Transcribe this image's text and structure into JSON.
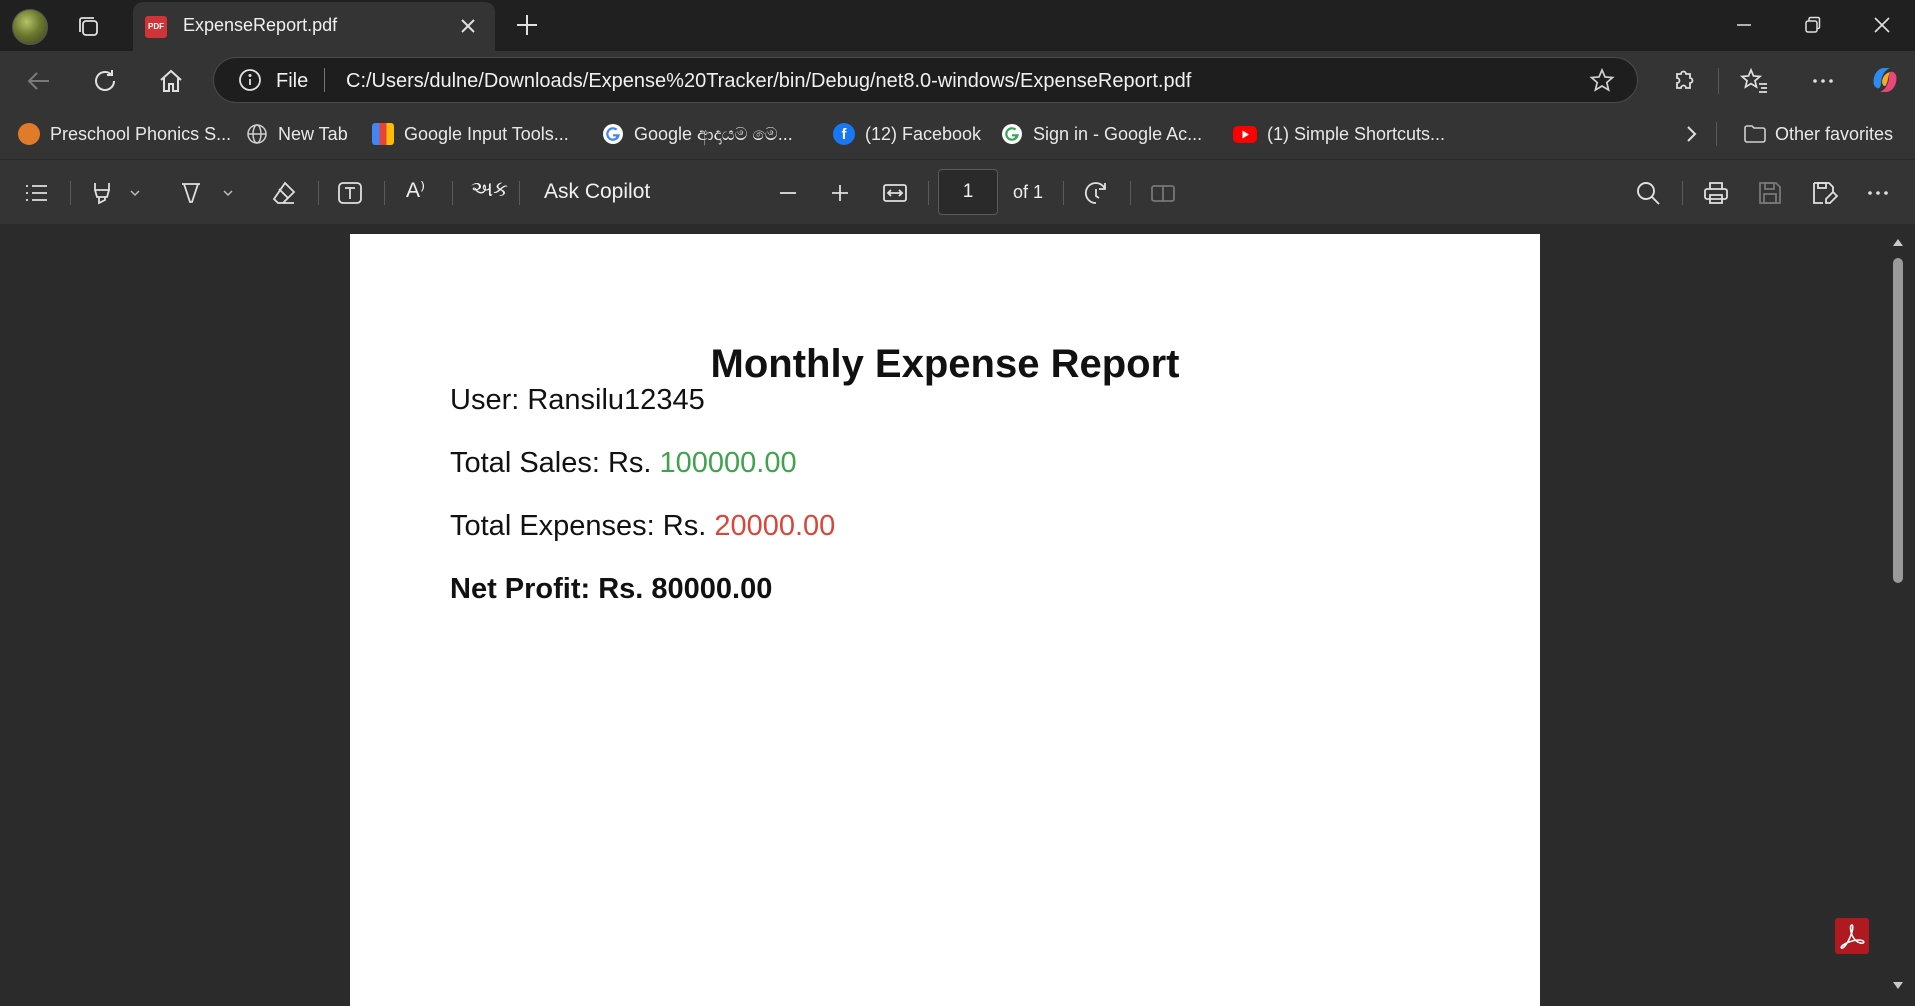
{
  "browser": {
    "tab": {
      "title": "ExpenseReport.pdf",
      "favicon": "PDF"
    },
    "address": {
      "scheme_label": "File",
      "url": "C:/Users/dulne/Downloads/Expense%20Tracker/bin/Debug/net8.0-windows/ExpenseReport.pdf"
    },
    "favorites": [
      {
        "label": "Preschool Phonics S...",
        "icon": "phonics-icon",
        "color": "#e07b2a"
      },
      {
        "label": "New Tab",
        "icon": "globe-icon",
        "color": "#cccccc"
      },
      {
        "label": "Google Input Tools...",
        "icon": "input-tools-icon",
        "color": "#4285f4"
      },
      {
        "label": "Google ආදායම මෙ...",
        "icon": "google-icon",
        "color": "#4285f4"
      },
      {
        "label": "(12) Facebook",
        "icon": "facebook-icon",
        "color": "#1877f2"
      },
      {
        "label": "Sign in - Google Ac...",
        "icon": "google-icon",
        "color": "#4285f4"
      },
      {
        "label": "(1) Simple Shortcuts...",
        "icon": "youtube-icon",
        "color": "#ff0000"
      }
    ],
    "other_favorites": "Other favorites"
  },
  "pdf_toolbar": {
    "ask_copilot": "Ask Copilot",
    "current_page": "1",
    "page_total": "of 1",
    "read_aloud_glyph": "A⁾",
    "translate_glyph": "અક"
  },
  "document": {
    "title": "Monthly Expense Report",
    "user_line": "User: Ransilu12345",
    "sales_label": "Total Sales: Rs. ",
    "sales_value": "100000.00",
    "expenses_label": "Total Expenses: Rs. ",
    "expenses_value": "20000.00",
    "net_profit_line": "Net Profit: Rs. 80000.00"
  },
  "colors": {
    "sales_value": "#3fa34d",
    "expenses_value": "#d9463a",
    "acrobat_badge": "#b0191f"
  }
}
